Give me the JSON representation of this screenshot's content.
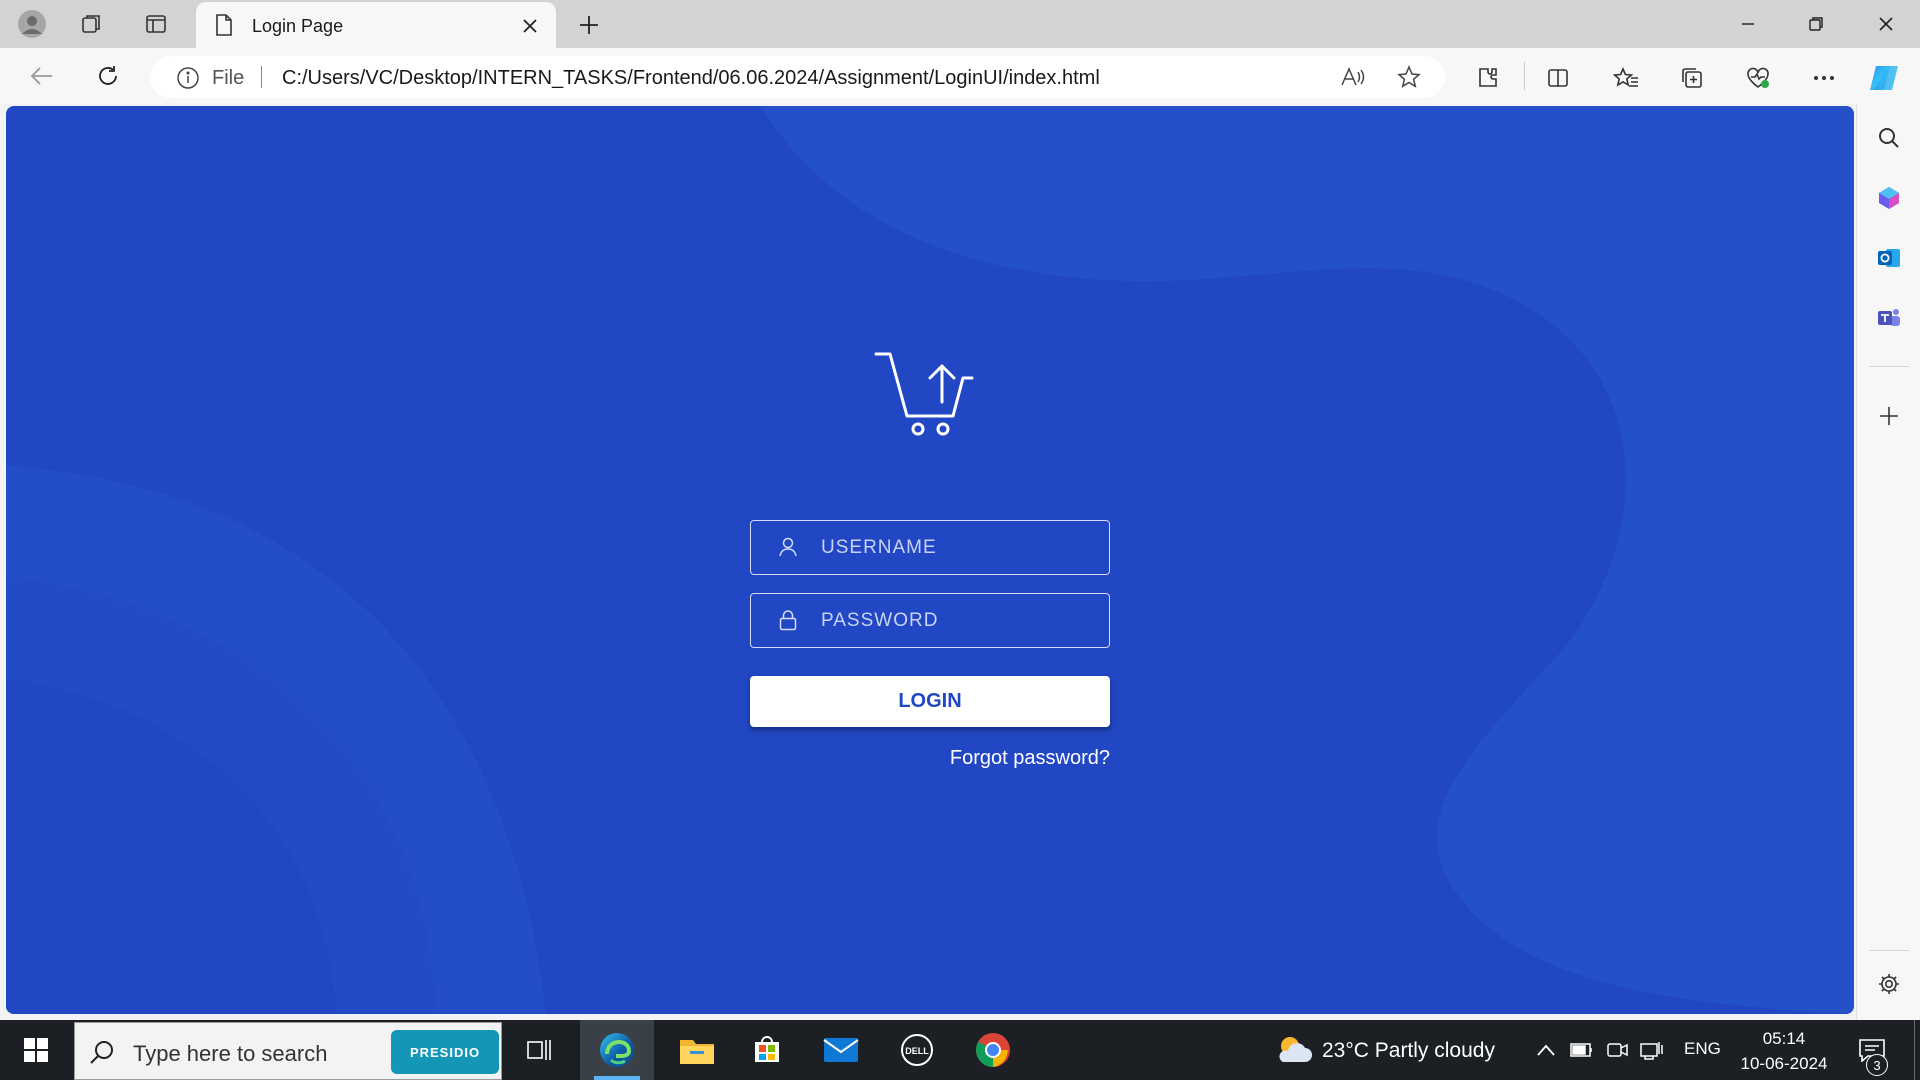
{
  "browser": {
    "tab_title": "Login Page",
    "address": {
      "scheme_label": "File",
      "url": "C:/Users/VC/Desktop/INTERN_TASKS/Frontend/06.06.2024/Assignment/LoginUI/index.html"
    }
  },
  "page": {
    "username_placeholder": "USERNAME",
    "password_placeholder": "PASSWORD",
    "login_label": "LOGIN",
    "forgot_label": "Forgot password?",
    "colors": {
      "background": "#2147c4",
      "button_text": "#2147c4"
    }
  },
  "taskbar": {
    "search_placeholder": "Type here to search",
    "search_badge": "PRESIDIO",
    "weather": "23°C  Partly cloudy",
    "language": "ENG",
    "time": "05:14",
    "date": "10-06-2024",
    "notification_count": "3"
  }
}
